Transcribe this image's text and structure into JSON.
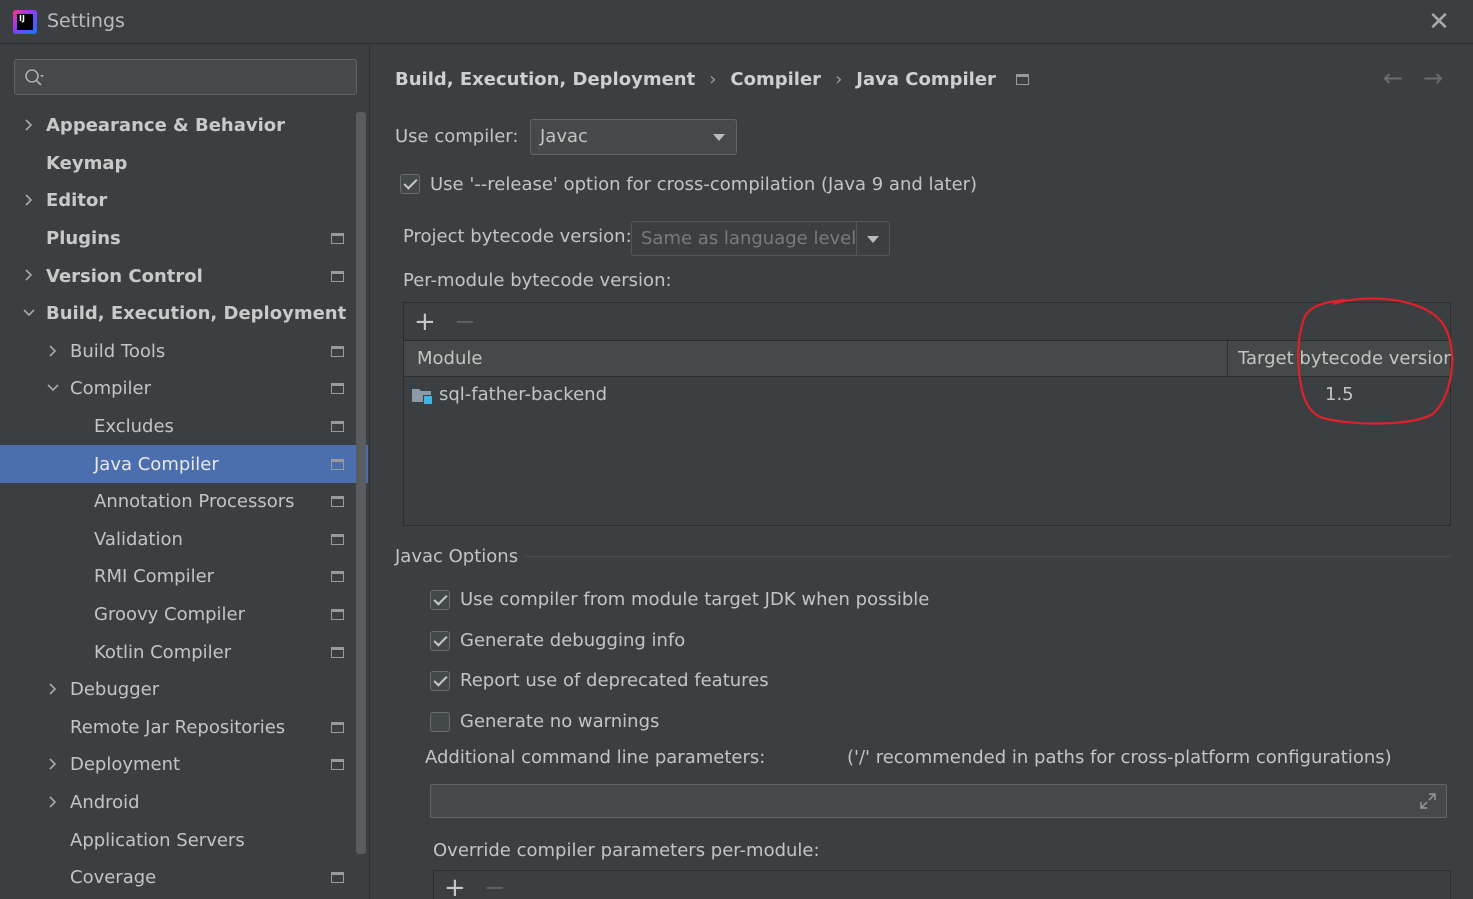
{
  "window": {
    "title": "Settings",
    "close_symbol": "✕"
  },
  "sidebar": {
    "search": {
      "value": "",
      "placeholder": ""
    },
    "items": [
      {
        "label": "Appearance & Behavior",
        "level": 0,
        "arrow": "right",
        "bold": true,
        "project_icon": false
      },
      {
        "label": "Keymap",
        "level": 0,
        "arrow": "none",
        "bold": true,
        "project_icon": false
      },
      {
        "label": "Editor",
        "level": 0,
        "arrow": "right",
        "bold": true,
        "project_icon": false
      },
      {
        "label": "Plugins",
        "level": 0,
        "arrow": "none",
        "bold": true,
        "project_icon": true
      },
      {
        "label": "Version Control",
        "level": 0,
        "arrow": "right",
        "bold": true,
        "project_icon": true
      },
      {
        "label": "Build, Execution, Deployment",
        "level": 0,
        "arrow": "down",
        "bold": true,
        "project_icon": false
      },
      {
        "label": "Build Tools",
        "level": 1,
        "arrow": "right",
        "bold": false,
        "project_icon": true
      },
      {
        "label": "Compiler",
        "level": 1,
        "arrow": "down",
        "bold": false,
        "project_icon": true
      },
      {
        "label": "Excludes",
        "level": 2,
        "arrow": "none",
        "bold": false,
        "project_icon": true
      },
      {
        "label": "Java Compiler",
        "level": 2,
        "arrow": "none",
        "bold": false,
        "project_icon": true,
        "selected": true
      },
      {
        "label": "Annotation Processors",
        "level": 2,
        "arrow": "none",
        "bold": false,
        "project_icon": true
      },
      {
        "label": "Validation",
        "level": 2,
        "arrow": "none",
        "bold": false,
        "project_icon": true
      },
      {
        "label": "RMI Compiler",
        "level": 2,
        "arrow": "none",
        "bold": false,
        "project_icon": true
      },
      {
        "label": "Groovy Compiler",
        "level": 2,
        "arrow": "none",
        "bold": false,
        "project_icon": true
      },
      {
        "label": "Kotlin Compiler",
        "level": 2,
        "arrow": "none",
        "bold": false,
        "project_icon": true
      },
      {
        "label": "Debugger",
        "level": 1,
        "arrow": "right",
        "bold": false,
        "project_icon": false
      },
      {
        "label": "Remote Jar Repositories",
        "level": 1,
        "arrow": "none",
        "bold": false,
        "project_icon": true
      },
      {
        "label": "Deployment",
        "level": 1,
        "arrow": "right",
        "bold": false,
        "project_icon": true
      },
      {
        "label": "Android",
        "level": 1,
        "arrow": "right",
        "bold": false,
        "project_icon": false
      },
      {
        "label": "Application Servers",
        "level": 1,
        "arrow": "none",
        "bold": false,
        "project_icon": false
      },
      {
        "label": "Coverage",
        "level": 1,
        "arrow": "none",
        "bold": false,
        "project_icon": true
      }
    ]
  },
  "breadcrumb": {
    "parts": [
      "Build, Execution, Deployment",
      "Compiler",
      "Java Compiler"
    ],
    "separator": "›"
  },
  "nav": {
    "back": "←",
    "forward": "→"
  },
  "compiler": {
    "use_compiler_label": "Use compiler:",
    "use_compiler_value": "Javac",
    "release_option_label": "Use '--release' option for cross-compilation (Java 9 and later)",
    "release_option_checked": true,
    "project_bytecode_label": "Project bytecode version:",
    "project_bytecode_value": "Same as language level",
    "per_module_label": "Per-module bytecode version:"
  },
  "module_table": {
    "add_symbol": "+",
    "remove_symbol": "−",
    "columns": [
      "Module",
      "Target bytecode version"
    ],
    "rows": [
      {
        "module": "sql-father-backend",
        "version": "1.5"
      }
    ]
  },
  "javac_options": {
    "title": "Javac Options",
    "checkboxes": [
      {
        "label": "Use compiler from module target JDK when possible",
        "checked": true
      },
      {
        "label": "Generate debugging info",
        "checked": true
      },
      {
        "label": "Report use of deprecated features",
        "checked": true
      },
      {
        "label": "Generate no warnings",
        "checked": false
      }
    ],
    "additional_params_label": "Additional command line parameters:",
    "additional_params_hint": "('/' recommended in paths for cross-platform configurations)",
    "additional_params_value": "",
    "override_label": "Override compiler parameters per-module:",
    "override_add_symbol": "+",
    "override_remove_symbol": "−"
  },
  "colors": {
    "background": "#3c3f41",
    "selection": "#4b6eaf",
    "annotation": "#e0202a"
  }
}
